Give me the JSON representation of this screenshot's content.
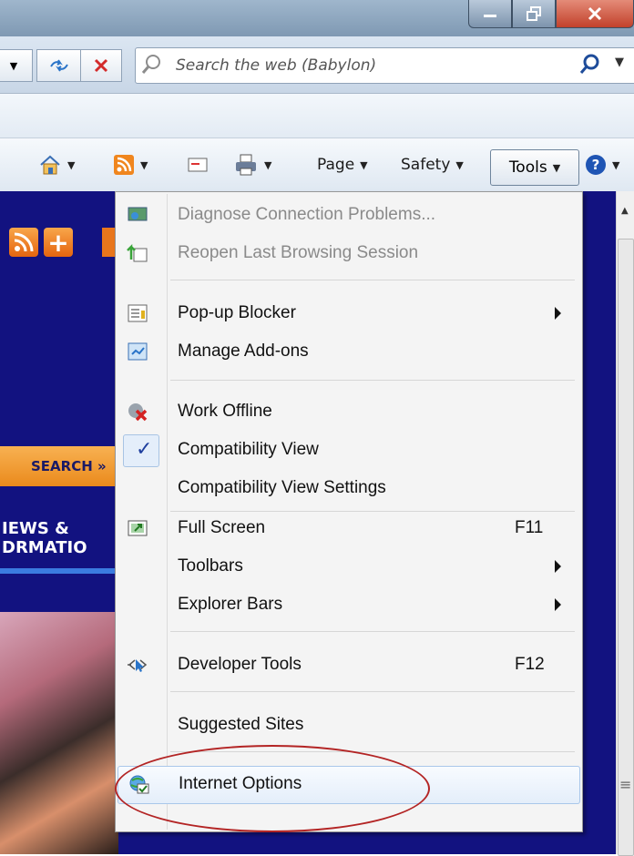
{
  "search": {
    "placeholder": "Search the web (Babylon)"
  },
  "commandbar": {
    "page_label": "Page",
    "safety_label": "Safety",
    "tools_label": "Tools"
  },
  "page": {
    "search_button": "SEARCH »",
    "news_heading_line1": "IEWS &",
    "news_heading_line2": "DRMATIO"
  },
  "menu": {
    "items": [
      {
        "label": "Diagnose Connection Problems...",
        "disabled": true,
        "icon": "network-diagnose-icon"
      },
      {
        "label": "Reopen Last Browsing Session",
        "disabled": true,
        "icon": "reopen-session-icon"
      },
      {
        "label": "Pop-up Blocker",
        "submenu": true,
        "icon": "popup-blocker-icon"
      },
      {
        "label": "Manage Add-ons",
        "icon": "manage-addons-icon"
      },
      {
        "label": "Work Offline",
        "icon": "work-offline-icon"
      },
      {
        "label": "Compatibility View",
        "checked": true
      },
      {
        "label": "Compatibility View Settings"
      },
      {
        "label": "Full Screen",
        "shortcut": "F11",
        "icon": "full-screen-icon"
      },
      {
        "label": "Toolbars",
        "submenu": true
      },
      {
        "label": "Explorer Bars",
        "submenu": true
      },
      {
        "label": "Developer Tools",
        "shortcut": "F12",
        "icon": "developer-tools-icon"
      },
      {
        "label": "Suggested Sites"
      },
      {
        "label": "Internet Options",
        "highlighted": true,
        "icon": "internet-options-icon"
      }
    ]
  },
  "colors": {
    "annotation": "#b32424",
    "page_background": "#121280",
    "menu_background": "#f4f4f4",
    "accent_orange": "#e9761c"
  }
}
